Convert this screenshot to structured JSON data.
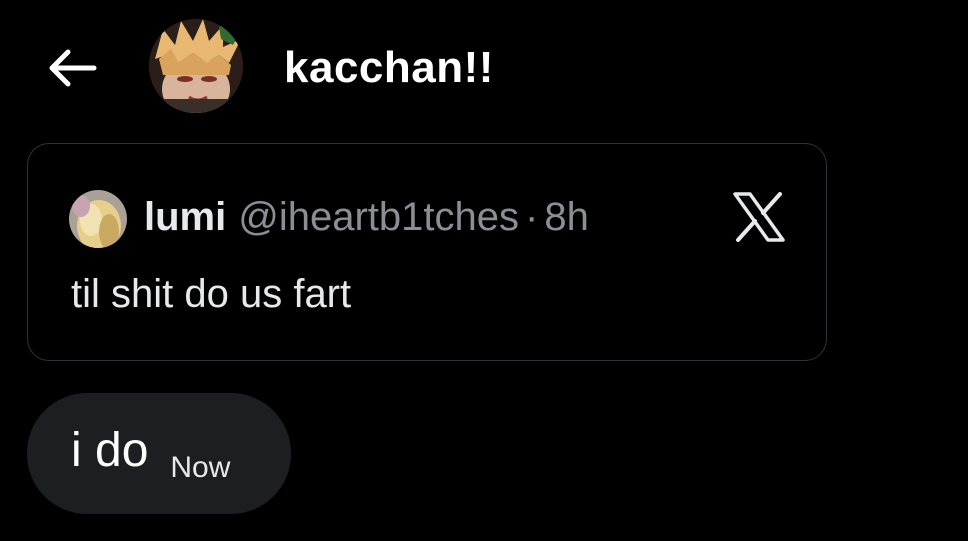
{
  "header": {
    "back_icon": "arrow-left-icon",
    "chat_name": "kacchan!!",
    "avatar": "profile-avatar"
  },
  "quoted_post": {
    "author": "lumi",
    "handle": "@iheartb1tches",
    "separator": "·",
    "time": "8h",
    "text": "til shit do us fart",
    "platform_icon": "x-logo-icon"
  },
  "message": {
    "text": "i do",
    "time": "Now"
  },
  "colors": {
    "background": "#000000",
    "card_border": "#2f3336",
    "bubble_background": "#1c1e21",
    "secondary_text": "#8b8f93",
    "primary_text": "#ffffff"
  }
}
